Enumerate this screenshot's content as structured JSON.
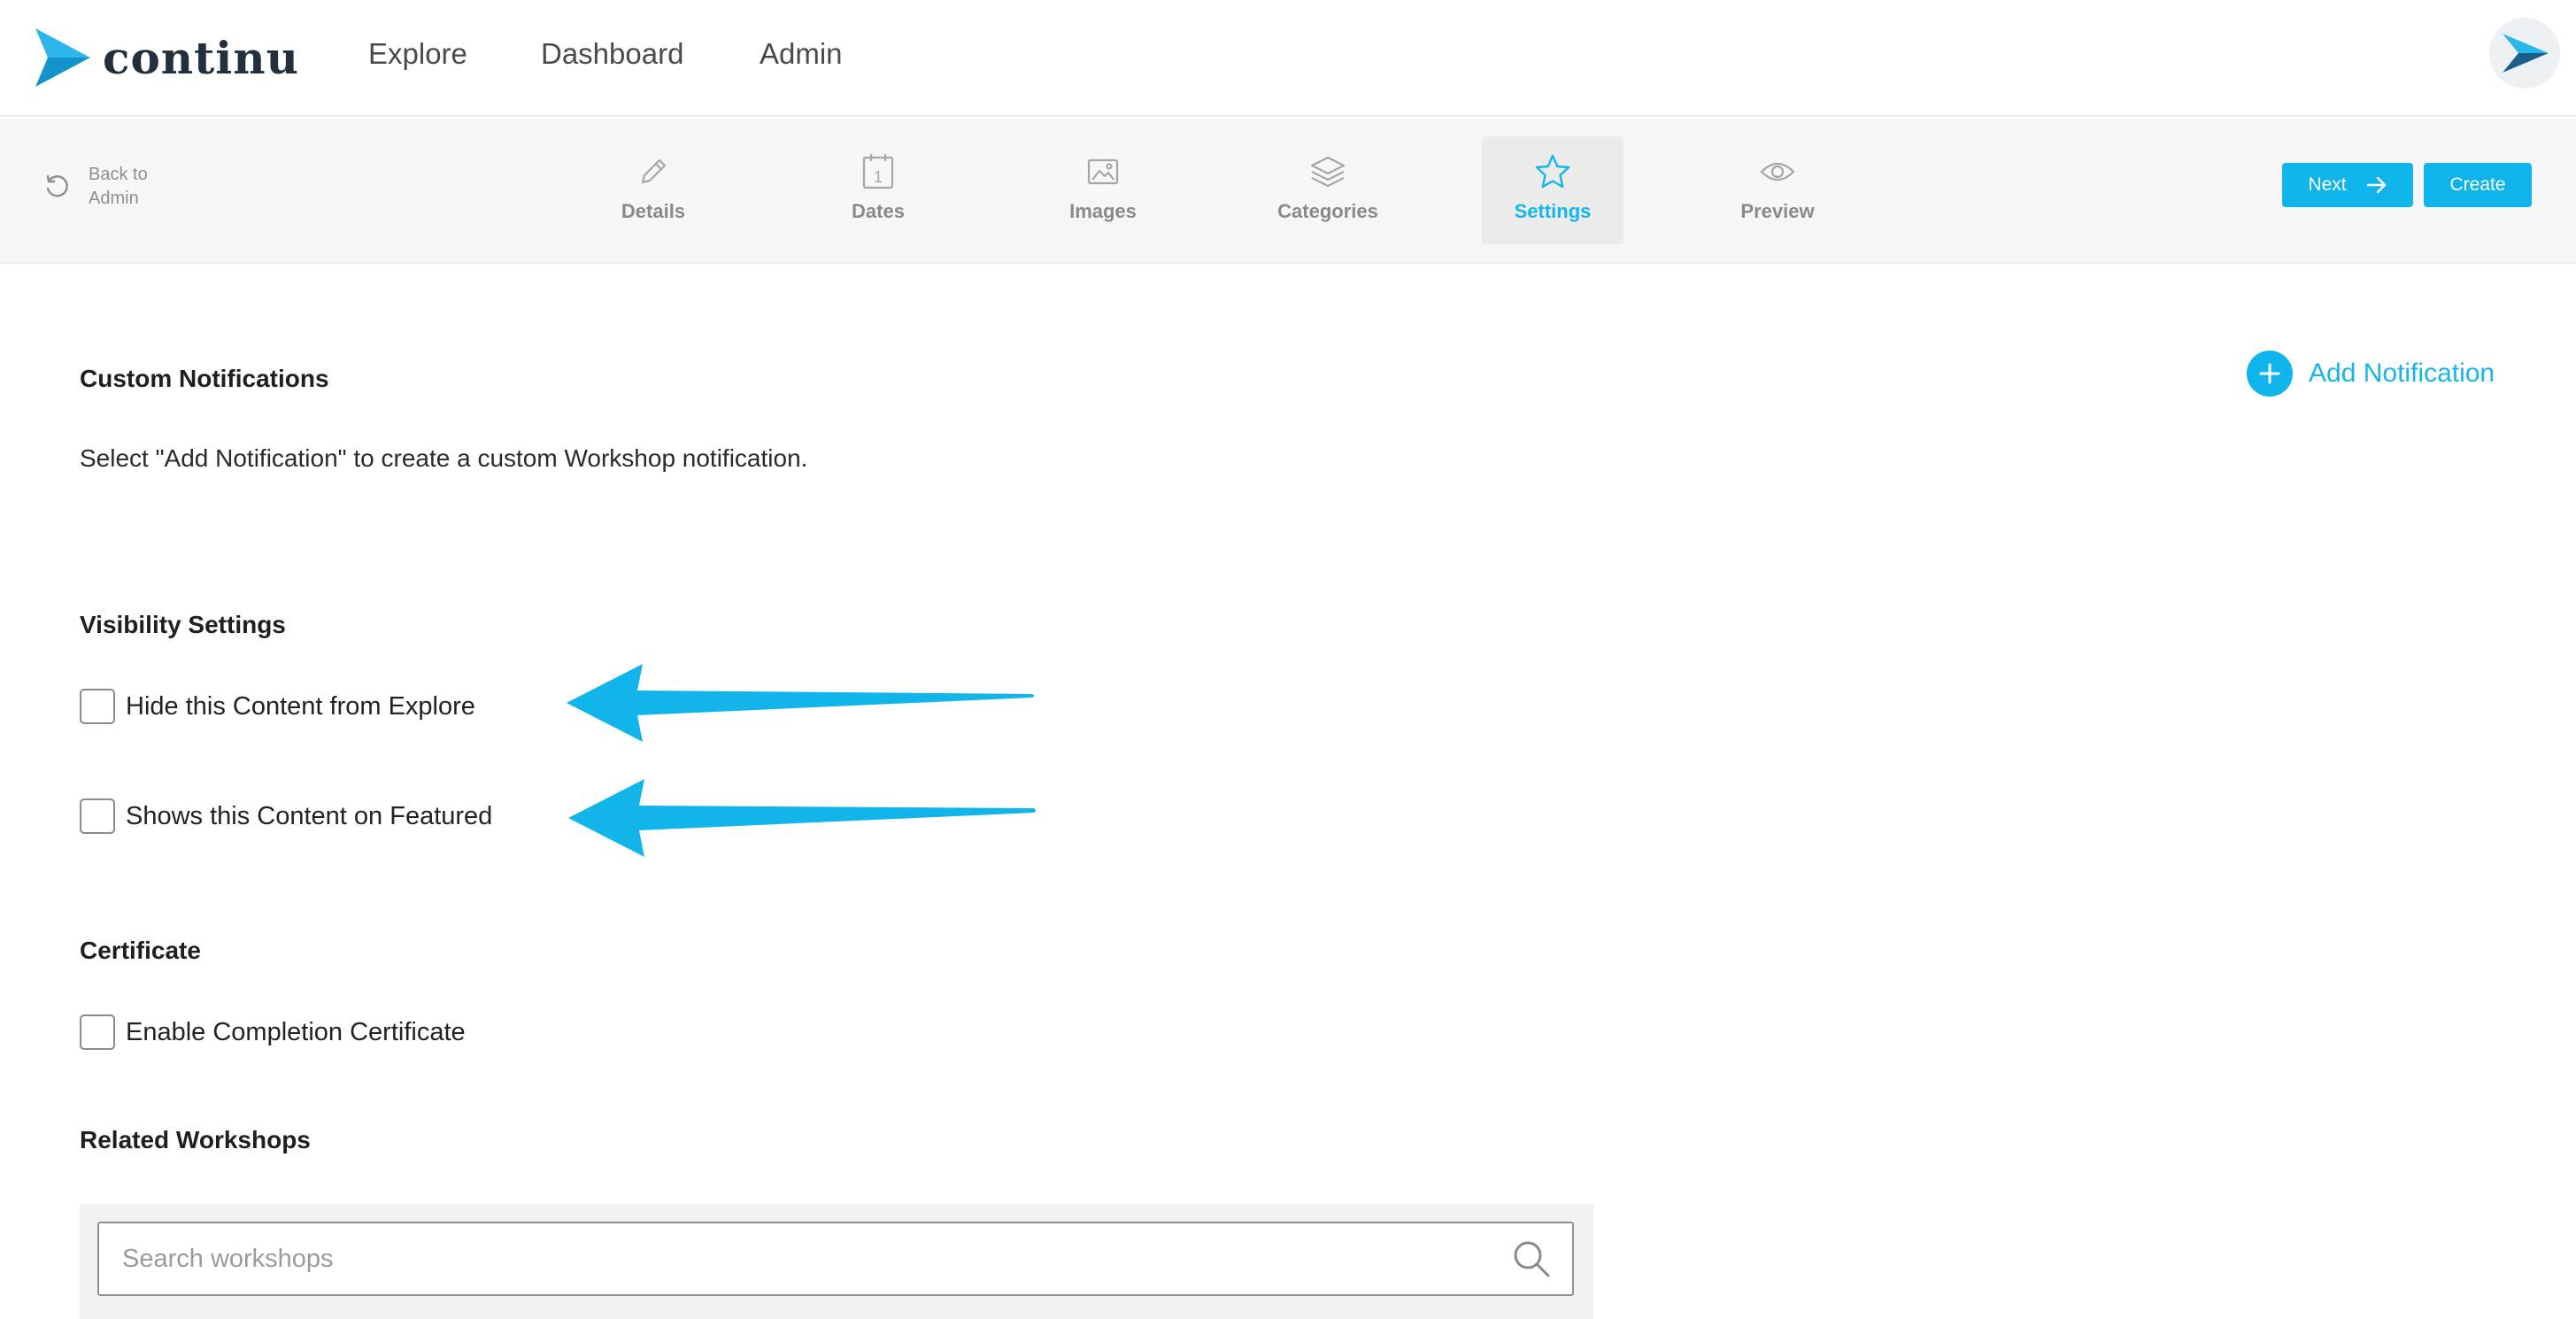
{
  "app": {
    "logo_text": "continu"
  },
  "nav": {
    "explore": "Explore",
    "dashboard": "Dashboard",
    "admin": "Admin"
  },
  "toolbar": {
    "back_label": "Back to Admin",
    "tabs": [
      {
        "label": "Details",
        "icon": "pencil-icon"
      },
      {
        "label": "Dates",
        "icon": "calendar-icon"
      },
      {
        "label": "Images",
        "icon": "image-icon"
      },
      {
        "label": "Categories",
        "icon": "layers-icon"
      },
      {
        "label": "Settings",
        "icon": "star-icon",
        "active": true
      },
      {
        "label": "Preview",
        "icon": "eye-icon"
      }
    ],
    "next_label": "Next",
    "create_label": "Create"
  },
  "notifications": {
    "title": "Custom Notifications",
    "add_label": "Add Notification",
    "description": "Select \"Add Notification\" to create a custom Workshop notification."
  },
  "visibility": {
    "title": "Visibility Settings",
    "options": [
      {
        "label": "Hide this Content from Explore",
        "checked": false
      },
      {
        "label": "Shows this Content on Featured",
        "checked": false
      }
    ]
  },
  "certificate": {
    "title": "Certificate",
    "option": {
      "label": "Enable Completion Certificate",
      "checked": false
    }
  },
  "related": {
    "title": "Related Workshops",
    "search_placeholder": "Search workshops"
  },
  "colors": {
    "accent": "#0fb5ea",
    "logo_dark": "#22303e",
    "toolbar_bg": "#f7f7f7"
  }
}
